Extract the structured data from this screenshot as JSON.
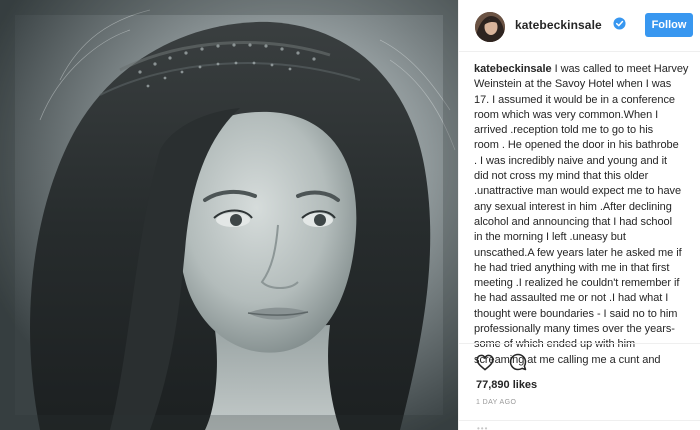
{
  "post": {
    "username": "katebeckinsale",
    "follow_label": "Follow",
    "caption_user": "katebeckinsale",
    "caption_lines": [
      " I was called to meet Harvey",
      "Weinstein at the Savoy Hotel when I was",
      "17. I assumed it would be in a conference",
      "room which was very common.When I",
      "arrived .reception told me to go to his",
      "room . He opened the door in his bathrobe",
      ". I was incredibly naive and young and it",
      "did not cross my mind that this older",
      ".unattractive man would expect me to have",
      "any sexual interest in him .After declining",
      "alcohol and announcing that I had school",
      "in the morning I left .uneasy but",
      "unscathed.A few years later he asked me if",
      "he had tried anything with me in that first",
      "meeting .I realized he couldn't remember if",
      "he had assaulted me or not .I had what I",
      "thought were boundaries - I said no to him",
      "professionally many times over the years-",
      "some of which ended up with him",
      "screaming at me calling me a cunt and"
    ],
    "likes": "77,890 likes",
    "timestamp": "1 DAY AGO",
    "comment_dots": "•••"
  },
  "icons": {
    "verified": "verified-badge-icon",
    "heart": "heart-icon",
    "comment": "comment-icon"
  },
  "colors": {
    "follow_button": "#3897f0",
    "verified_badge": "#3897f0",
    "text": "#262626",
    "muted": "#999999"
  }
}
